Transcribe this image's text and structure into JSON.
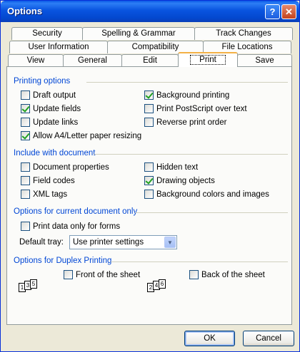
{
  "window": {
    "title": "Options",
    "help_glyph": "?",
    "close_glyph": "✕"
  },
  "tabs": {
    "row1": [
      "Security",
      "Spelling & Grammar",
      "Track Changes"
    ],
    "row2": [
      "User Information",
      "Compatibility",
      "File Locations"
    ],
    "row3": [
      "View",
      "General",
      "Edit",
      "Print",
      "Save"
    ],
    "active": "Print"
  },
  "printing_options": {
    "title": "Printing options",
    "items": [
      {
        "label": "Draft output",
        "checked": false
      },
      {
        "label": "Update fields",
        "checked": true
      },
      {
        "label": "Update links",
        "checked": false
      },
      {
        "label": "Allow A4/Letter paper resizing",
        "checked": true
      },
      {
        "label": "Background printing",
        "checked": true
      },
      {
        "label": "Print PostScript over text",
        "checked": false
      },
      {
        "label": "Reverse print order",
        "checked": false
      }
    ]
  },
  "include_with_document": {
    "title": "Include with document",
    "items": [
      {
        "label": "Document properties",
        "checked": false
      },
      {
        "label": "Field codes",
        "checked": false
      },
      {
        "label": "XML tags",
        "checked": false
      },
      {
        "label": "Hidden text",
        "checked": false
      },
      {
        "label": "Drawing objects",
        "checked": true
      },
      {
        "label": "Background colors and images",
        "checked": false
      }
    ]
  },
  "current_document": {
    "title": "Options for current document only",
    "print_data_only": {
      "label": "Print data only for forms",
      "checked": false
    },
    "default_tray_label": "Default tray:",
    "default_tray_value": "Use printer settings"
  },
  "duplex": {
    "title": "Options for Duplex Printing",
    "front": {
      "label": "Front of the sheet",
      "checked": false,
      "pages": [
        "1",
        "3",
        "5"
      ]
    },
    "back": {
      "label": "Back of the sheet",
      "checked": false,
      "pages": [
        "2",
        "4",
        "6"
      ]
    }
  },
  "buttons": {
    "ok": "OK",
    "cancel": "Cancel"
  }
}
